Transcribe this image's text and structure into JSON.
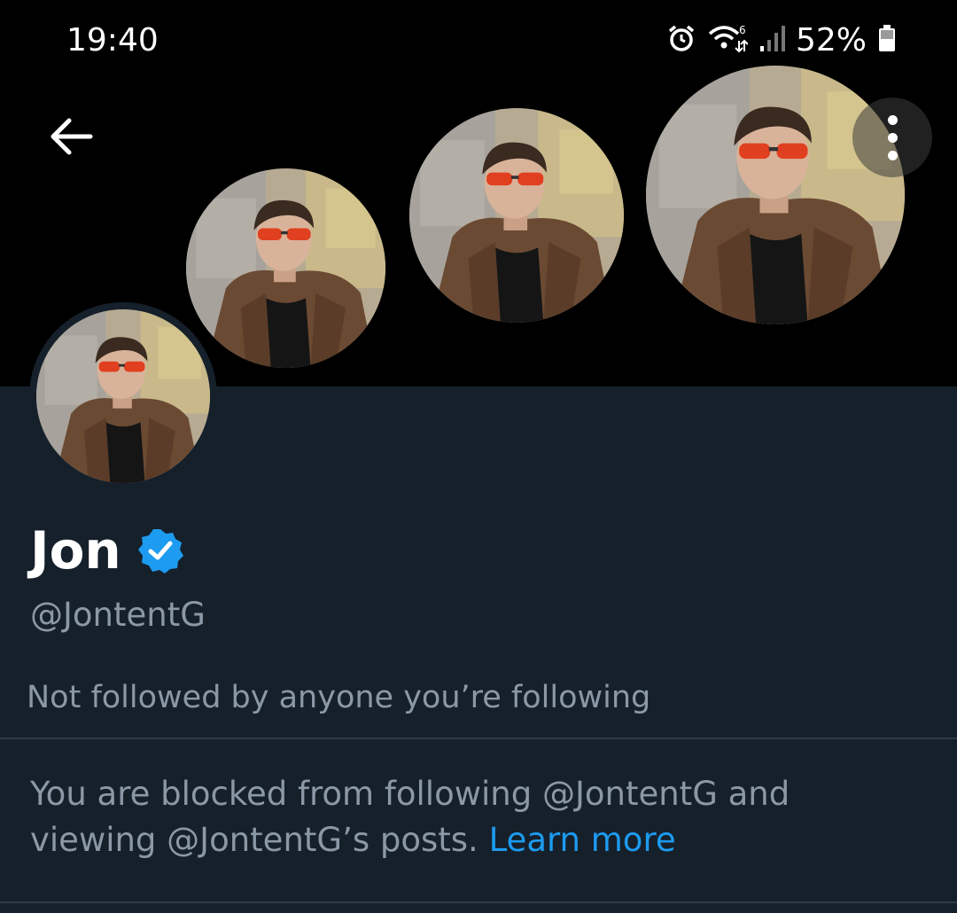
{
  "status_bar": {
    "time": "19:40",
    "battery_percent": "52%",
    "icons": [
      "alarm-icon",
      "wifi-6-icon",
      "cell-signal-icon",
      "battery-icon"
    ]
  },
  "header": {
    "back_icon": "arrow-left-icon",
    "more_icon": "more-vertical-icon"
  },
  "profile": {
    "display_name": "Jon",
    "verified": true,
    "handle": "@JontentG",
    "followers_note": "Not followed by anyone you’re following"
  },
  "blocked_notice": {
    "text": "You are blocked from following @JontentG and viewing @JontentG’s posts.",
    "link_label": "Learn more"
  },
  "colors": {
    "background": "#15202b",
    "banner": "#000000",
    "accent": "#1d9bf0",
    "secondary_text": "#8b98a5"
  }
}
